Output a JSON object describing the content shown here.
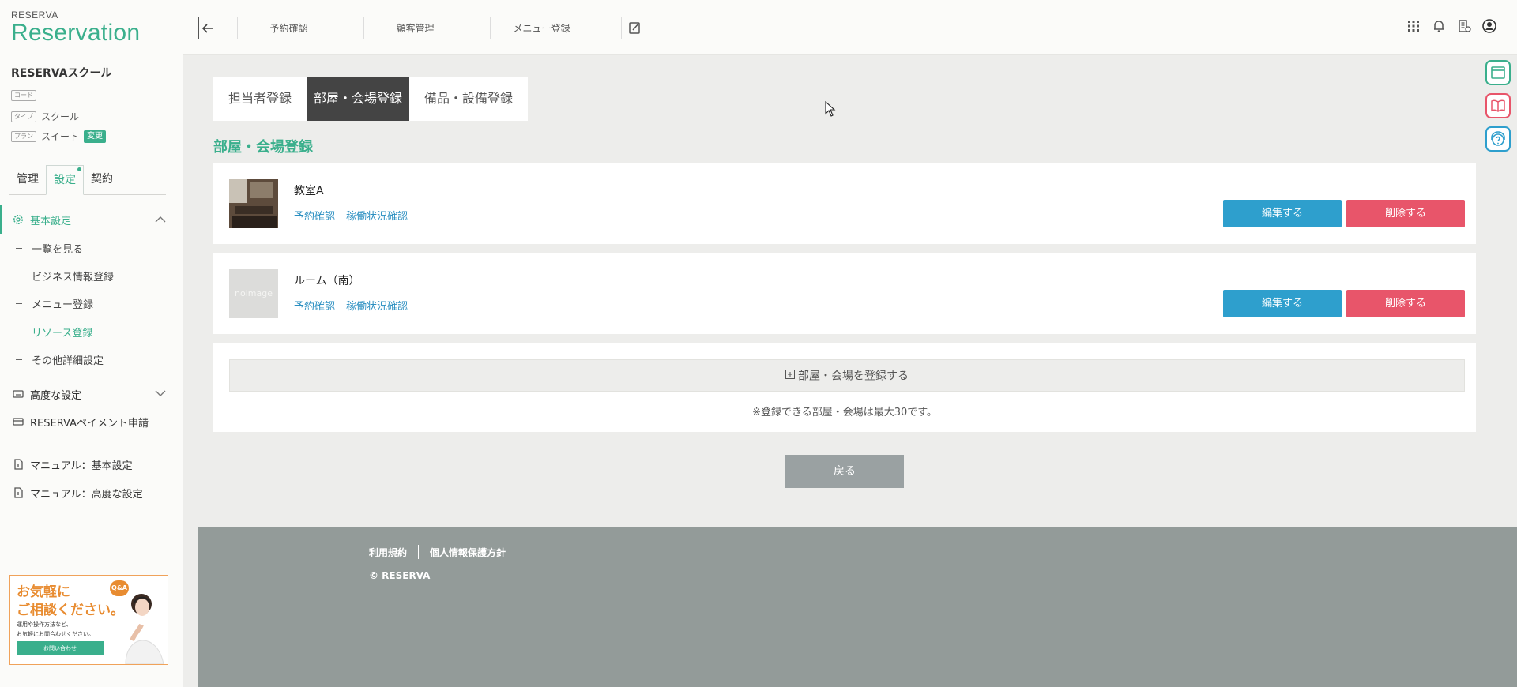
{
  "brand": {
    "small": "RESERVA",
    "big": "Reservation",
    "accent": "#3aaf8c"
  },
  "sidebar": {
    "shop_name": "RESERVAスクール",
    "meta": [
      {
        "tag": "コード",
        "value": ""
      },
      {
        "tag": "タイプ",
        "value": "スクール"
      },
      {
        "tag": "プラン",
        "value": "スイート",
        "badge": "変更"
      }
    ],
    "tabs": [
      "管理",
      "設定",
      "契約"
    ],
    "sections": {
      "basic": "基本設定",
      "items": [
        "一覧を見る",
        "ビジネス情報登録",
        "メニュー登録",
        "リソース登録",
        "その他詳細設定"
      ],
      "advanced": "高度な設定",
      "payment": "RESERVAペイメント申請",
      "manual_basic": "マニュアル：基本設定",
      "manual_advanced": "マニュアル：高度な設定"
    },
    "banner": {
      "line1": "お気軽に",
      "line2": "ご相談ください。",
      "qa": "Q&A",
      "desc1": "運用や操作方法など、",
      "desc2": "お気軽にお問合わせください。",
      "button": "お問い合わせ"
    }
  },
  "topbar": {
    "nav": [
      "予約確認",
      "顧客管理",
      "メニュー登録"
    ],
    "icons": [
      "grid-icon",
      "bell-icon",
      "building-icon",
      "user-icon"
    ]
  },
  "main": {
    "tabs": [
      "担当者登録",
      "部屋・会場登録",
      "備品・設備登録"
    ],
    "title": "部屋・会場登録",
    "resources": [
      {
        "name": "教室A",
        "link1": "予約確認",
        "link2": "稼働状況確認",
        "edit": "編集する",
        "delete": "削除する",
        "thumb": "photo"
      },
      {
        "name": "ルーム（南）",
        "link1": "予約確認",
        "link2": "稼働状況確認",
        "edit": "編集する",
        "delete": "削除する",
        "thumb": "placeholder",
        "thumb_text": "noimage"
      }
    ],
    "add_label": "部屋・会場を登録する",
    "note": "※登録できる部屋・会場は最大30です。",
    "back_label": "戻る"
  },
  "footer": {
    "terms": "利用規約",
    "privacy": "個人情報保護方針",
    "copyright": "© RESERVA"
  },
  "colors": {
    "edit": "#2e9fcd",
    "delete": "#e8556a",
    "back": "#9aa1a2",
    "footer": "#939b99"
  }
}
